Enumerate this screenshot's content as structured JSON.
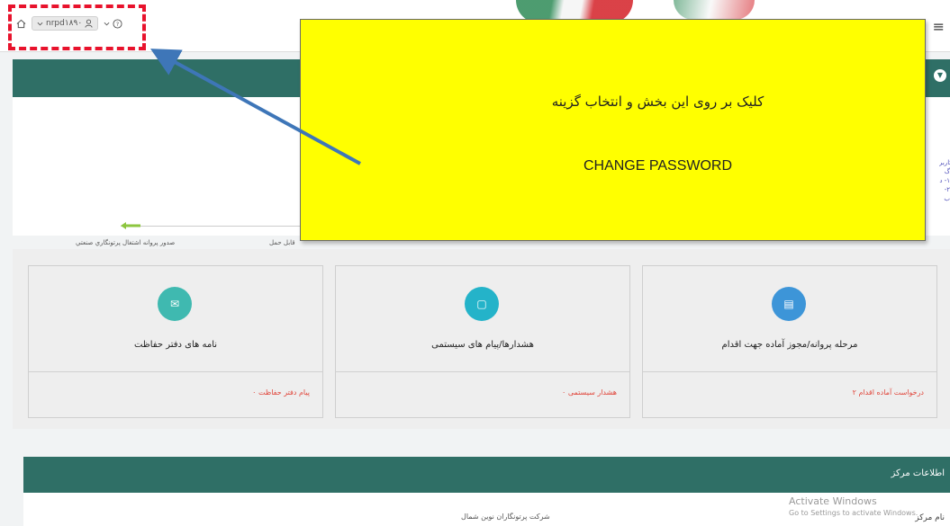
{
  "topbar": {
    "user_label": "nrpd۱۸۹۰",
    "banner_text": "",
    "menu_glyph": "≡"
  },
  "panel1": {
    "steps": [
      {
        "label": "صدور پروانه اشتغال پرتونگاري صنعتي"
      },
      {
        "label": "قابل حمل"
      }
    ],
    "side_text": "کاربر گ ۱- د ۲- ب"
  },
  "cards": [
    {
      "title": "نامه های دفتر حفاظت",
      "footer": "۰ پیام دفتر حفاظت",
      "icon": "envelope-icon",
      "color": "#3fb9b0"
    },
    {
      "title": "هشدارها/پیام های سیستمی",
      "footer": "۰ هشدار سیستمی",
      "icon": "message-icon",
      "color": "#24b3c9"
    },
    {
      "title": "مرحله پروانه/مجوز آماده جهت اقدام",
      "footer": "۲ درخواست آماده اقدام",
      "icon": "document-icon",
      "color": "#3d95d8"
    }
  ],
  "info_panel": {
    "title": "اطلاعات مرکز",
    "label": "نام مرکز",
    "value": "شرکت پرتونگاران نوین شمال"
  },
  "watermark": {
    "line1": "Activate Windows",
    "line2": "Go to Settings to activate Windows."
  },
  "callout": {
    "line1": "کلیک بر روی این بخش و انتخاب گزینه",
    "line2": "CHANGE PASSWORD"
  },
  "colors": {
    "header_teal": "#2f6f66",
    "callout_yellow": "#ffff00",
    "highlight_red": "#e8122c",
    "arrow_blue": "#3e76b8",
    "progress_green": "#8dc63f"
  }
}
